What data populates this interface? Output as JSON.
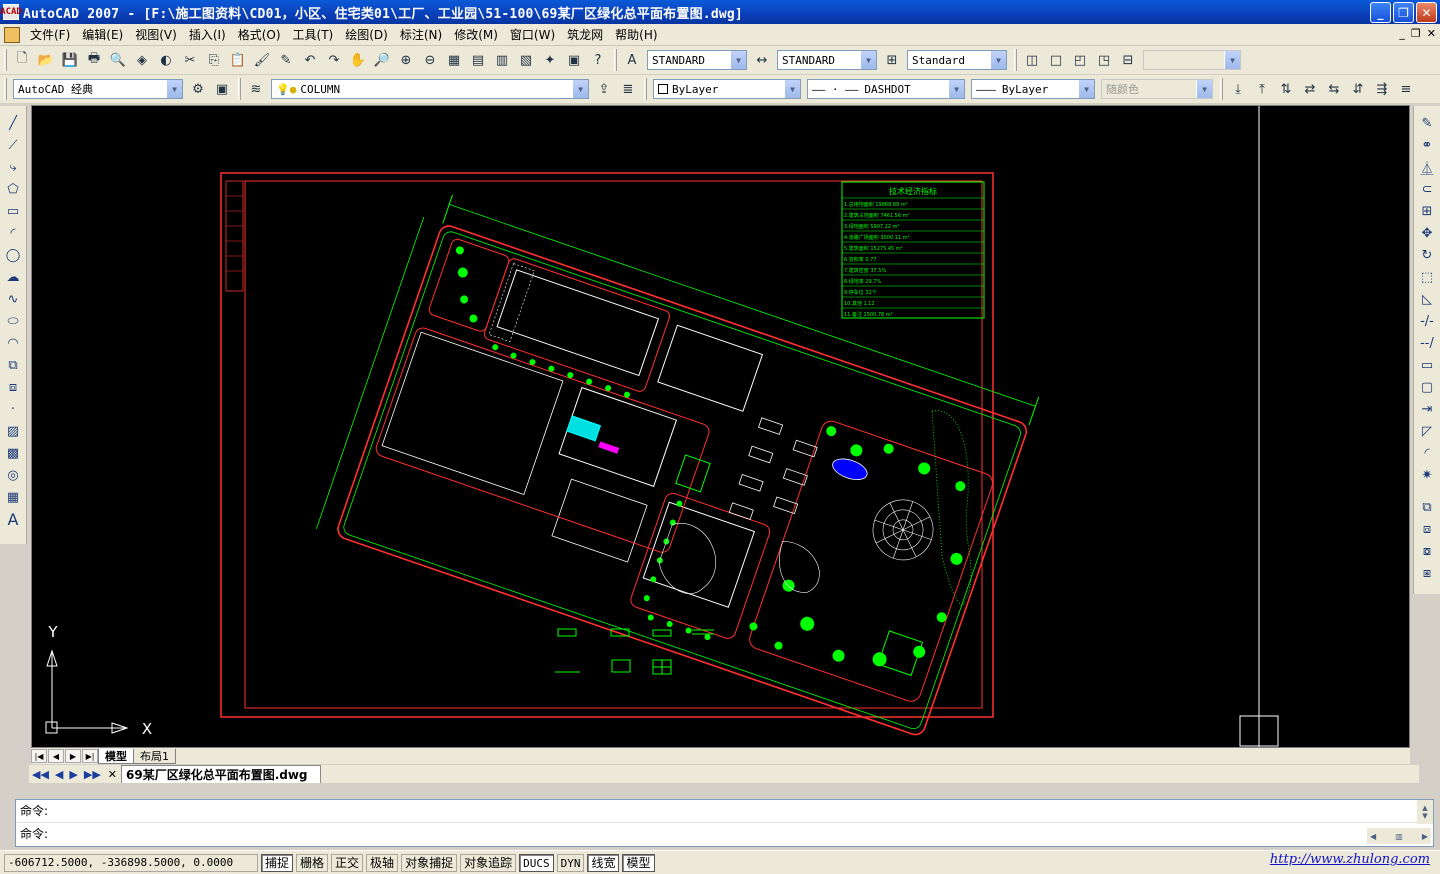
{
  "window": {
    "title": "AutoCAD 2007 - [F:\\施工图资料\\CD01，小区、住宅类01\\工厂、工业园\\51-100\\69某厂区绿化总平面布置图.dwg]",
    "app_icon_text": "ACAD",
    "minimize": "_",
    "maximize": "❐",
    "close": "✕"
  },
  "menubar": {
    "items": [
      "文件(F)",
      "编辑(E)",
      "视图(V)",
      "插入(I)",
      "格式(O)",
      "工具(T)",
      "绘图(D)",
      "标注(N)",
      "修改(M)",
      "窗口(W)",
      "筑龙网",
      "帮助(H)"
    ],
    "mdi_buttons": [
      "_",
      "❐",
      "✕"
    ]
  },
  "toolbar1": {
    "text_style": "STANDARD",
    "dim_style": "STANDARD",
    "table_style": "Standard",
    "disabled_combo": ""
  },
  "toolbar2": {
    "workspace": "AutoCAD 经典",
    "layer": "COLUMN",
    "color": "ByLayer",
    "linetype": "DASHDOT",
    "lineweight": "ByLayer",
    "plotstyle": "随颜色"
  },
  "drawing": {
    "table_title": "技术经济指标",
    "table_rows": [
      "1.总用地面积  19868.89 m²",
      "2.建筑占地面积  7461.56 m²",
      "3.绿地面积  5907.22 m²",
      "4.道路广场面积  3000.11 m²",
      "5.建筑面积  15275.45 m²",
      "6.容积率  0.77",
      "7.建筑密度  37.5%",
      "8.绿地率  29.7%",
      "9.停车位  32个",
      "10.其他  1.12",
      "11.备注  1500.78 m²"
    ],
    "axis_y": "Y",
    "axis_x": "X"
  },
  "layout_tabs": {
    "nav": [
      "|◀",
      "◀",
      "▶",
      "▶|"
    ],
    "tabs": [
      "模型",
      "布局1"
    ]
  },
  "doc_tabs": {
    "nav": [
      "◀◀",
      "◀",
      "▶",
      "▶▶",
      "✕"
    ],
    "active": "69某厂区绿化总平面布置图.dwg"
  },
  "command": {
    "line1": "命令:",
    "line2": "命令:"
  },
  "statusbar": {
    "coords": "-606712.5000, -336898.5000, 0.0000",
    "buttons": [
      {
        "label": "捕捉",
        "on": true
      },
      {
        "label": "栅格",
        "on": false
      },
      {
        "label": "正交",
        "on": false
      },
      {
        "label": "极轴",
        "on": false
      },
      {
        "label": "对象捕捉",
        "on": false
      },
      {
        "label": "对象追踪",
        "on": false
      },
      {
        "label": "DUCS",
        "on": true
      },
      {
        "label": "DYN",
        "on": false
      },
      {
        "label": "线宽",
        "on": true
      },
      {
        "label": "模型",
        "on": true
      }
    ],
    "url": "http://www.zhulong.com"
  },
  "colors": {
    "title_bar": "#0a46c4",
    "toolbar": "#ece9d8",
    "canvas": "#000000",
    "cad_green": "#00ff00",
    "cad_red": "#ff3030",
    "cad_white": "#ffffff",
    "url": "#1212c8"
  }
}
